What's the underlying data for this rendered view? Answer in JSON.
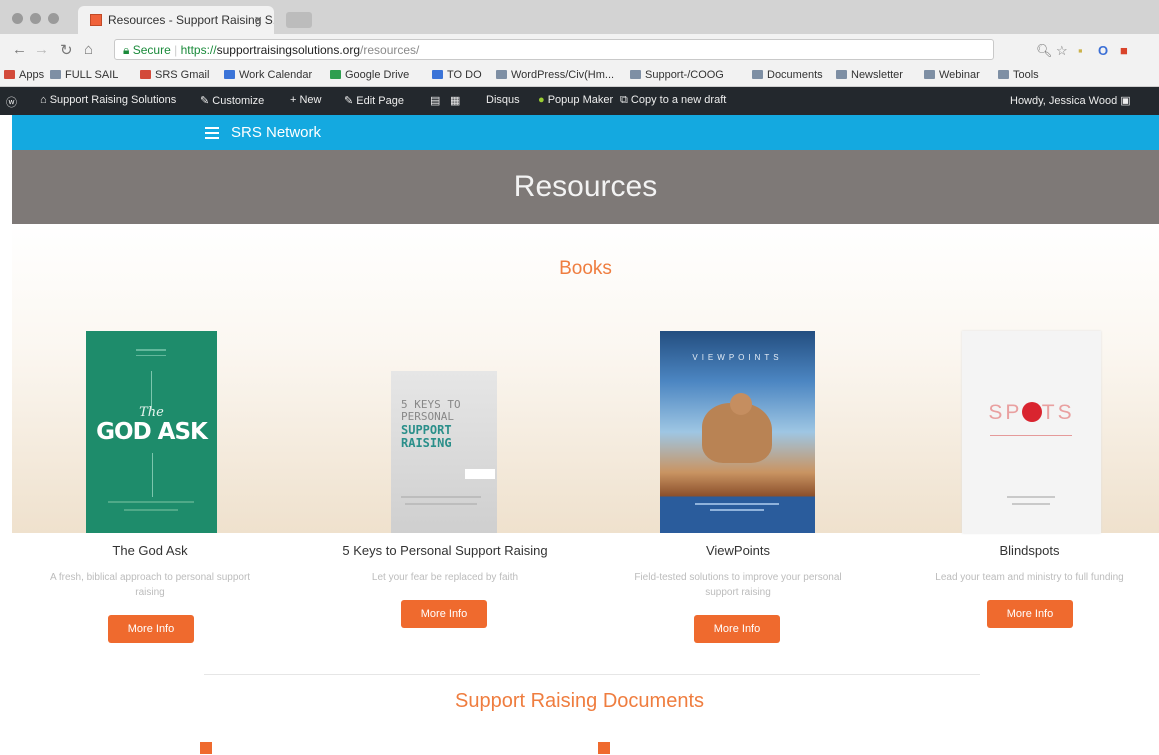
{
  "browser": {
    "tab_title": "Resources - Support Raising S...",
    "close_glyph": "×",
    "url_secure_label": "Secure",
    "url_scheme": "https://",
    "url_host": "supportraisingsolutions.org",
    "url_path": "/resources/",
    "bookmarks": [
      "Apps",
      "FULL SAIL",
      "SRS Gmail",
      "Work Calendar",
      "Google Drive",
      "TO DO",
      "WordPress/Civ(Hm...",
      "Support-/COOG",
      "Documents",
      "Newsletter",
      "Webinar",
      "Tools"
    ]
  },
  "admin_bar": {
    "site_name": "Support Raising Solutions",
    "customize": "Customize",
    "new": "New",
    "edit_page": "Edit Page",
    "disqus": "Disqus",
    "popup_maker": "Popup Maker",
    "copy_draft": "Copy to a new draft",
    "howdy": "Howdy, Jessica Wood"
  },
  "site_nav": {
    "title": "SRS Network"
  },
  "hero": {
    "title": "Resources"
  },
  "books_section": {
    "heading": "Books",
    "items": [
      {
        "title": "The God Ask",
        "desc": "A fresh, biblical approach to personal support raising",
        "button": "More Info"
      },
      {
        "title": "5 Keys to Personal Support Raising",
        "desc": "Let your fear be replaced by faith",
        "button": "More Info"
      },
      {
        "title": "ViewPoints",
        "desc": "Field-tested solutions to improve your personal support raising",
        "button": "More Info"
      },
      {
        "title": "Blindspots",
        "desc": "Lead your team and ministry to full funding",
        "button": "More Info"
      }
    ]
  },
  "covers": {
    "god_ask": {
      "title_small": "The",
      "title_big": "GOD ASK"
    },
    "five_keys": {
      "line1": "5 KEYS TO",
      "line2": "PERSONAL",
      "line3": "SUPPORT",
      "line4": "RAISING"
    },
    "viewpoints": {
      "title": "VIEWPOINTS"
    },
    "blindspots": {
      "title": "SPOTS"
    }
  },
  "documents_section": {
    "heading": "Support Raising Documents"
  },
  "colors": {
    "accent": "#ef6a2e",
    "nav_blue": "#14a9e0",
    "hero_gray": "#7e7977"
  }
}
